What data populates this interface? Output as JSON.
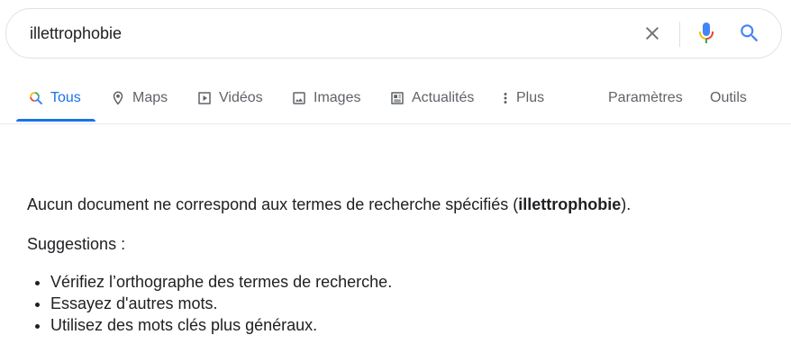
{
  "search": {
    "query": "illettrophobie"
  },
  "tabs": [
    {
      "label": "Tous",
      "icon": "search-multicolor-icon",
      "active": true
    },
    {
      "label": "Maps",
      "icon": "map-pin-icon"
    },
    {
      "label": "Vidéos",
      "icon": "video-icon"
    },
    {
      "label": "Images",
      "icon": "image-icon"
    },
    {
      "label": "Actualités",
      "icon": "news-icon"
    },
    {
      "label": "Plus",
      "icon": "more-vert-icon"
    }
  ],
  "tools": {
    "settings": "Paramètres",
    "tools": "Outils"
  },
  "results": {
    "message_before": "Aucun document ne correspond aux termes de recherche spécifiés (",
    "query_bold": "illettrophobie",
    "message_after": ").",
    "suggestions_title": "Suggestions :",
    "suggestions": [
      "Vérifiez l’orthographe des termes de recherche.",
      "Essayez d'autres mots.",
      "Utilisez des mots clés plus généraux."
    ]
  },
  "colors": {
    "accent": "#1a73e8",
    "text": "#202124",
    "muted": "#5f6368",
    "border": "#dfe1e5"
  }
}
